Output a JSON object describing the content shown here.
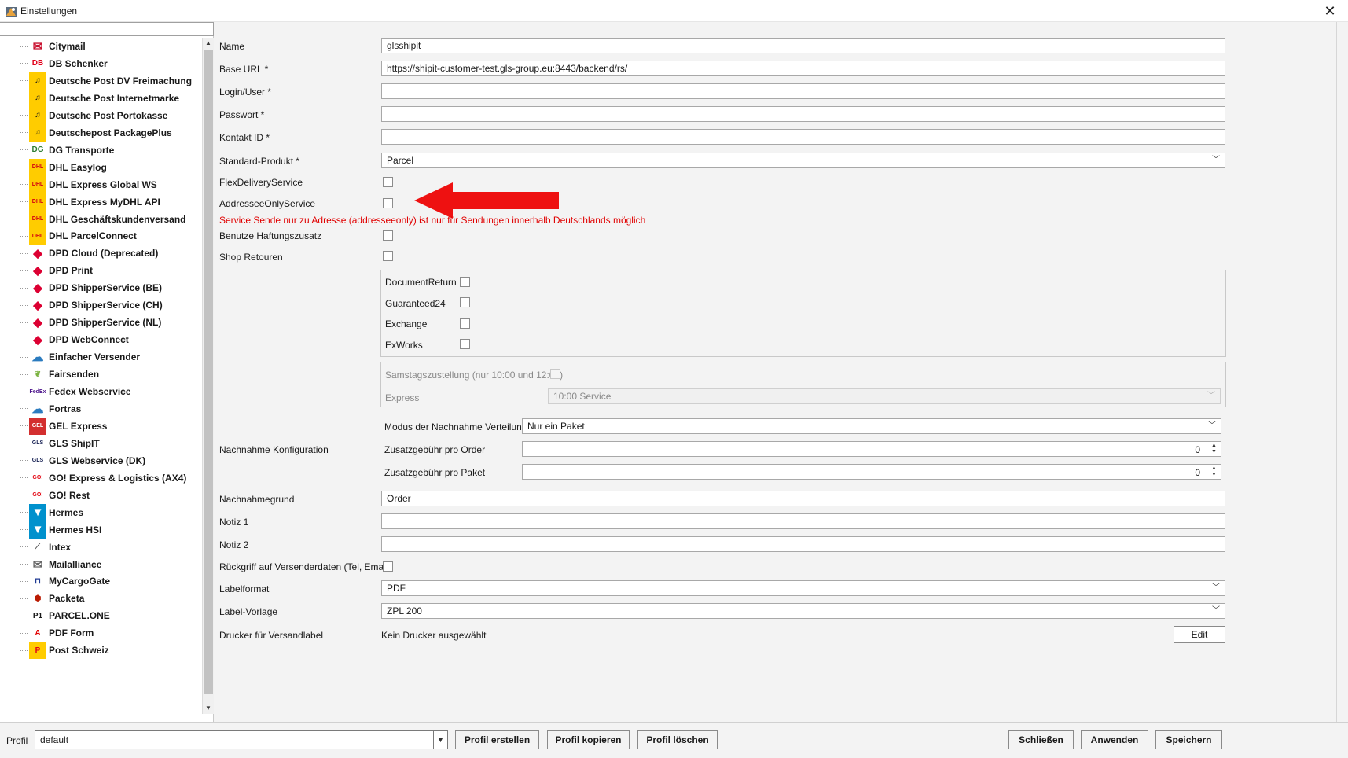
{
  "window": {
    "title": "Einstellungen",
    "close_glyph": "✕"
  },
  "sidebar": {
    "search_value": "",
    "items": [
      {
        "label": "Citymail",
        "icon": "citymail-icon",
        "glyph": "✉",
        "color": "#c8102e",
        "bg": "#ffffff"
      },
      {
        "label": "DB Schenker",
        "icon": "db-schenker-icon",
        "glyph": "DB",
        "color": "#e2001a",
        "bg": "#ffffff"
      },
      {
        "label": "Deutsche Post DV Freimachung",
        "icon": "deutsche-post-icon",
        "glyph": "♫",
        "color": "#1a1a1a",
        "bg": "#ffcc00"
      },
      {
        "label": "Deutsche Post Internetmarke",
        "icon": "deutsche-post-icon",
        "glyph": "♫",
        "color": "#1a1a1a",
        "bg": "#ffcc00"
      },
      {
        "label": "Deutsche Post Portokasse",
        "icon": "deutsche-post-icon",
        "glyph": "♫",
        "color": "#1a1a1a",
        "bg": "#ffcc00"
      },
      {
        "label": "Deutschepost PackagePlus",
        "icon": "deutsche-post-icon",
        "glyph": "♫",
        "color": "#1a1a1a",
        "bg": "#ffcc00"
      },
      {
        "label": "DG Transporte",
        "icon": "dg-transporte-icon",
        "glyph": "DG",
        "color": "#2e7d32",
        "bg": "#ffffff"
      },
      {
        "label": "DHL Easylog",
        "icon": "dhl-icon",
        "glyph": "DHL",
        "color": "#d40511",
        "bg": "#ffcc00"
      },
      {
        "label": "DHL Express Global WS",
        "icon": "dhl-icon",
        "glyph": "DHL",
        "color": "#d40511",
        "bg": "#ffcc00"
      },
      {
        "label": "DHL Express MyDHL API",
        "icon": "dhl-icon",
        "glyph": "DHL",
        "color": "#d40511",
        "bg": "#ffcc00"
      },
      {
        "label": "DHL Geschäftskundenversand",
        "icon": "dhl-icon",
        "glyph": "DHL",
        "color": "#d40511",
        "bg": "#ffcc00"
      },
      {
        "label": "DHL ParcelConnect",
        "icon": "dhl-icon",
        "glyph": "DHL",
        "color": "#d40511",
        "bg": "#ffcc00"
      },
      {
        "label": "DPD Cloud (Deprecated)",
        "icon": "dpd-icon",
        "glyph": "◆",
        "color": "#dc0032",
        "bg": "#ffffff"
      },
      {
        "label": "DPD Print",
        "icon": "dpd-icon",
        "glyph": "◆",
        "color": "#dc0032",
        "bg": "#ffffff"
      },
      {
        "label": "DPD ShipperService (BE)",
        "icon": "dpd-icon",
        "glyph": "◆",
        "color": "#dc0032",
        "bg": "#ffffff"
      },
      {
        "label": "DPD ShipperService (CH)",
        "icon": "dpd-icon",
        "glyph": "◆",
        "color": "#dc0032",
        "bg": "#ffffff"
      },
      {
        "label": "DPD ShipperService (NL)",
        "icon": "dpd-icon",
        "glyph": "◆",
        "color": "#dc0032",
        "bg": "#ffffff"
      },
      {
        "label": "DPD WebConnect",
        "icon": "dpd-icon",
        "glyph": "◆",
        "color": "#dc0032",
        "bg": "#ffffff"
      },
      {
        "label": "Einfacher Versender",
        "icon": "cloud-icon",
        "glyph": "☁",
        "color": "#2b7bbf",
        "bg": "#ffffff"
      },
      {
        "label": "Fairsenden",
        "icon": "leaf-icon",
        "glyph": "❦",
        "color": "#7cb342",
        "bg": "#ffffff"
      },
      {
        "label": "Fedex Webservice",
        "icon": "fedex-icon",
        "glyph": "FedEx",
        "color": "#4d148c",
        "bg": "#ffffff"
      },
      {
        "label": "Fortras",
        "icon": "cloud-icon",
        "glyph": "☁",
        "color": "#2b7bbf",
        "bg": "#ffffff"
      },
      {
        "label": "GEL Express",
        "icon": "gel-express-icon",
        "glyph": "GEL",
        "color": "#ffffff",
        "bg": "#d32f2f"
      },
      {
        "label": "GLS ShipIT",
        "icon": "gls-icon",
        "glyph": "GLS",
        "color": "#172154",
        "bg": "#ffffff"
      },
      {
        "label": "GLS Webservice (DK)",
        "icon": "gls-icon",
        "glyph": "GLS",
        "color": "#172154",
        "bg": "#ffffff"
      },
      {
        "label": "GO! Express & Logistics (AX4)",
        "icon": "go-icon",
        "glyph": "GO!",
        "color": "#e30613",
        "bg": "#ffffff"
      },
      {
        "label": "GO! Rest",
        "icon": "go-icon",
        "glyph": "GO!",
        "color": "#e30613",
        "bg": "#ffffff"
      },
      {
        "label": "Hermes",
        "icon": "hermes-icon",
        "glyph": "▼",
        "color": "#ffffff",
        "bg": "#0091cd"
      },
      {
        "label": "Hermes HSI",
        "icon": "hermes-icon",
        "glyph": "▼",
        "color": "#ffffff",
        "bg": "#0091cd"
      },
      {
        "label": "Intex",
        "icon": "intex-icon",
        "glyph": "⟋",
        "color": "#555555",
        "bg": "#ffffff"
      },
      {
        "label": "Mailalliance",
        "icon": "mail-icon",
        "glyph": "✉",
        "color": "#666666",
        "bg": "#ffffff"
      },
      {
        "label": "MyCargoGate",
        "icon": "mycargogate-icon",
        "glyph": "⊓",
        "color": "#1f3a93",
        "bg": "#ffffff"
      },
      {
        "label": "Packeta",
        "icon": "packeta-icon",
        "glyph": "⬢",
        "color": "#ba1b02",
        "bg": "#ffffff"
      },
      {
        "label": "PARCEL.ONE",
        "icon": "parcel-one-icon",
        "glyph": "P1",
        "color": "#1a1a1a",
        "bg": "#ffffff"
      },
      {
        "label": "PDF Form",
        "icon": "pdf-icon",
        "glyph": "A",
        "color": "#e20000",
        "bg": "#ffffff"
      },
      {
        "label": "Post Schweiz",
        "icon": "post-schweiz-icon",
        "glyph": "P",
        "color": "#e2001a",
        "bg": "#ffcc00"
      }
    ]
  },
  "form": {
    "name_label": "Name",
    "name_value": "glsshipit",
    "base_url_label": "Base URL *",
    "base_url_value": "https://shipit-customer-test.gls-group.eu:8443/backend/rs/",
    "login_label": "Login/User *",
    "login_value": "",
    "password_label": "Passwort *",
    "password_value": "",
    "contact_label": "Kontakt ID *",
    "contact_value": "",
    "product_label": "Standard-Produkt *",
    "product_value": "Parcel",
    "flex_label": "FlexDeliveryService",
    "addressee_label": "AddresseeOnlyService",
    "addressee_error": "Service Sende nur zu Adresse (addresseeonly) ist nur für Sendungen innerhalb Deutschlands möglich",
    "liability_label": "Benutze Haftungszusatz",
    "shop_returns_label": "Shop Retouren",
    "services": [
      "DocumentReturn",
      "Guaranteed24",
      "Exchange",
      "ExWorks"
    ],
    "saturday_label": "Samstagszustellung (nur 10:00 und 12:00)",
    "express_label": "Express",
    "express_value": "10:00 Service",
    "cod_config_label": "Nachnahme Konfiguration",
    "cod_mode_label": "Modus der Nachnahme Verteilung",
    "cod_mode_value": "Nur ein Paket",
    "fee_order_label": "Zusatzgebühr pro Order",
    "fee_order_value": "0",
    "fee_parcel_label": "Zusatzgebühr pro Paket",
    "fee_parcel_value": "0",
    "cod_reason_label": "Nachnahmegrund",
    "cod_reason_value": "Order",
    "note1_label": "Notiz 1",
    "note1_value": "",
    "note2_label": "Notiz 2",
    "note2_value": "",
    "fallback_label": "Rückgriff auf Versenderdaten (Tel, Email)",
    "labelformat_label": "Labelformat",
    "labelformat_value": "PDF",
    "template_label": "Label-Vorlage",
    "template_value": "ZPL 200",
    "printer_label": "Drucker für Versandlabel",
    "printer_value": "Kein Drucker ausgewählt",
    "edit_label": "Edit"
  },
  "footer": {
    "profile_label": "Profil",
    "profile_value": "default",
    "create_label": "Profil erstellen",
    "copy_label": "Profil kopieren",
    "delete_label": "Profil löschen",
    "close_label": "Schließen",
    "apply_label": "Anwenden",
    "save_label": "Speichern"
  },
  "colors": {
    "annotation_arrow": "#ee1111",
    "error_text": "#e00000",
    "panel_bg": "#f3f3f3"
  }
}
